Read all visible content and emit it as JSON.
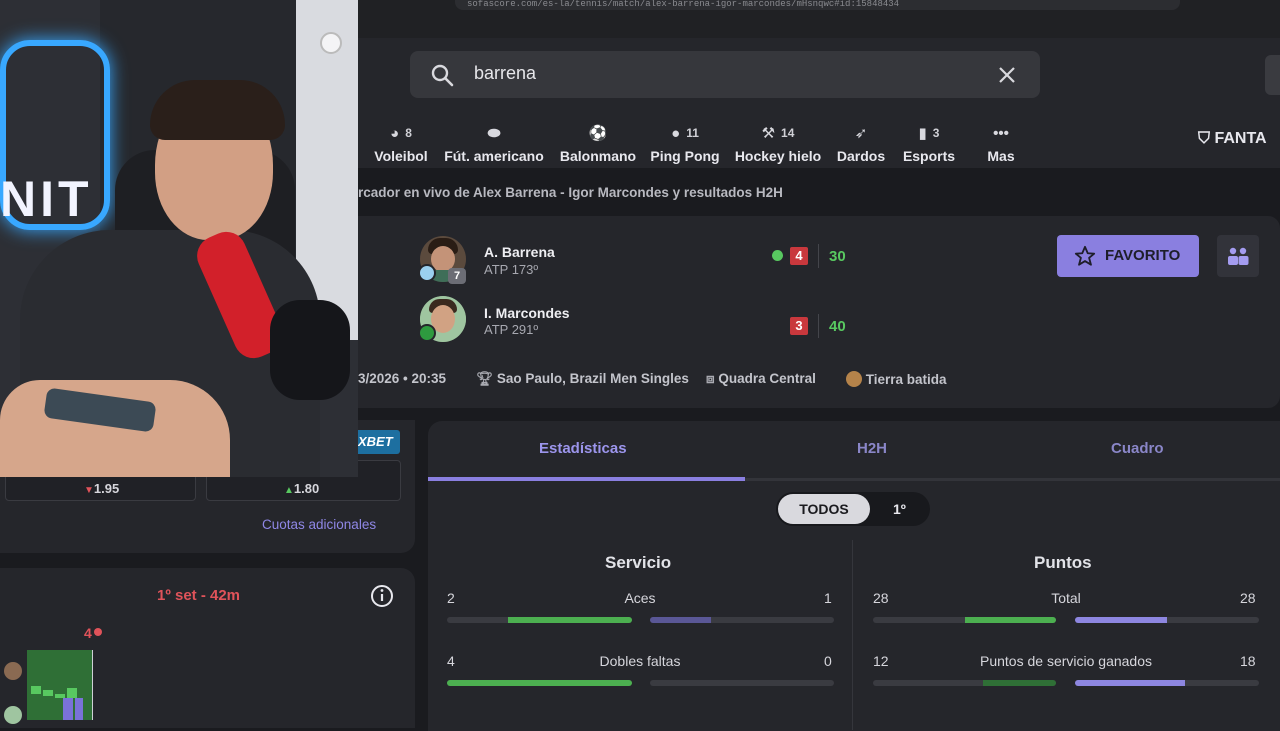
{
  "browser": {
    "url": "sofascore.com/es-la/tennis/match/alex-barrena-igor-marcondes/mHsnqwc#id:15848434"
  },
  "search": {
    "query": "barrena"
  },
  "sports": [
    {
      "label": "Voleibol",
      "count": "8",
      "icon": "volleyball-icon"
    },
    {
      "label": "Fút. americano",
      "count": "",
      "icon": "american-football-icon"
    },
    {
      "label": "Balonmano",
      "count": "",
      "icon": "handball-icon"
    },
    {
      "label": "Ping Pong",
      "count": "11",
      "icon": "table-tennis-icon"
    },
    {
      "label": "Hockey hielo",
      "count": "14",
      "icon": "ice-hockey-icon"
    },
    {
      "label": "Dardos",
      "count": "",
      "icon": "darts-icon"
    },
    {
      "label": "Esports",
      "count": "3",
      "icon": "esports-icon"
    },
    {
      "label": "Mas",
      "count": "",
      "icon": "more-dots-icon"
    }
  ],
  "fantasy_label": "FANTA",
  "breadcrumb": "rcador en vivo de Alex Barrena - Igor Marcondes y resultados H2H",
  "match": {
    "player1": {
      "name": "A. Barrena",
      "rank": "ATP 173º",
      "seed": "7",
      "set": "4",
      "points": "30"
    },
    "player2": {
      "name": "I. Marcondes",
      "rank": "ATP 291º",
      "set": "3",
      "points": "40"
    },
    "favorite_label": "FAVORITO",
    "datetime": "3/2026 • 20:35",
    "tournament": "Sao Paulo, Brazil Men Singles",
    "court": "Quadra Central",
    "surface": "Tierra batida"
  },
  "odds": {
    "bookmaker": "XBET",
    "home": "1.95",
    "away": "1.80",
    "more_label": "Cuotas adicionales"
  },
  "momentum": {
    "set_label": "1º set - 42m",
    "marker": "4"
  },
  "stats": {
    "tabs": [
      "Estadísticas",
      "H2H",
      "Cuadro"
    ],
    "period_all": "TODOS",
    "period_first": "1º",
    "sections": [
      {
        "title": "Servicio",
        "rows": [
          {
            "label": "Aces",
            "home": "2",
            "away": "1",
            "home_frac": 0.67,
            "away_frac": 0.33
          },
          {
            "label": "Dobles faltas",
            "home": "4",
            "away": "0",
            "home_frac": 1.0,
            "away_frac": 0.0
          }
        ]
      },
      {
        "title": "Puntos",
        "rows": [
          {
            "label": "Total",
            "home": "28",
            "away": "28",
            "home_frac": 0.5,
            "away_frac": 0.5
          },
          {
            "label": "Puntos de servicio ganados",
            "home": "12",
            "away": "18",
            "home_frac": 0.4,
            "away_frac": 0.6
          }
        ]
      }
    ]
  },
  "colors": {
    "accent": "#8a7fe0",
    "home_bar": "#4caf50",
    "away_bar": "#8d86e0",
    "live_red": "#c9383d",
    "points_green": "#58c860"
  }
}
